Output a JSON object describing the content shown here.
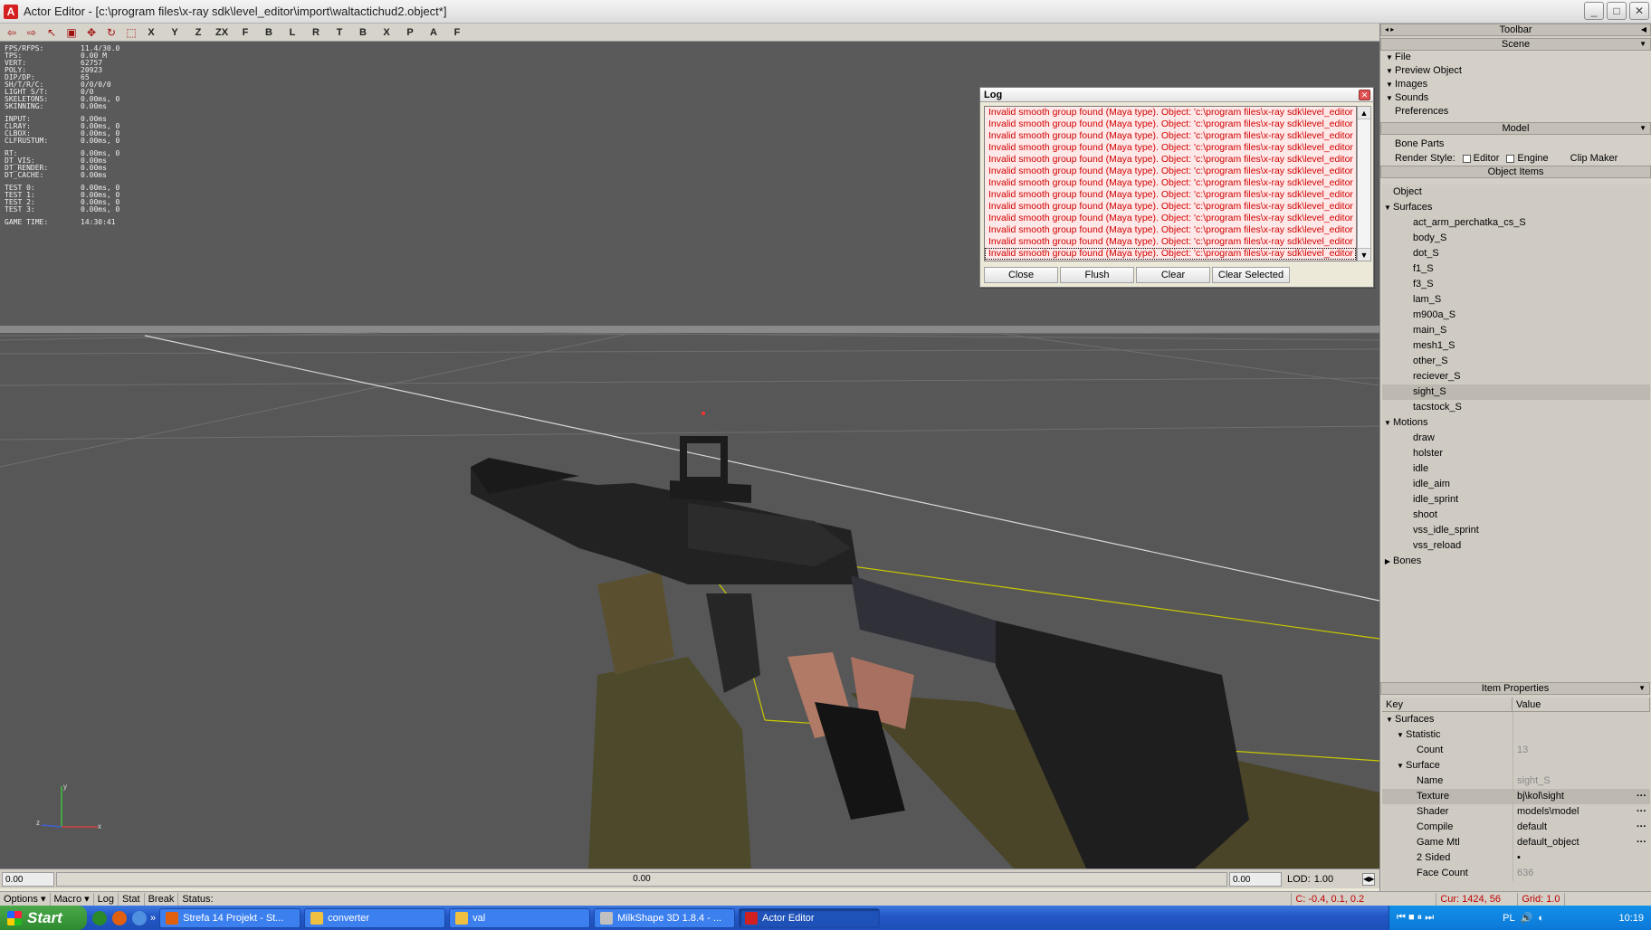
{
  "window": {
    "title": "Actor Editor - [c:\\program files\\x-ray sdk\\level_editor\\import\\waltactichud2.object*]",
    "app_icon": "A"
  },
  "toolbar": {
    "items": [
      "X",
      "Y",
      "Z",
      "ZX",
      "F",
      "B",
      "L",
      "R",
      "T",
      "B",
      "X",
      "P",
      "A",
      "F"
    ]
  },
  "stats": [
    {
      "k": "FPS/RFPS:",
      "v": "11.4/30.0"
    },
    {
      "k": "TPS:",
      "v": "0.00 M"
    },
    {
      "k": "VERT:",
      "v": "62757"
    },
    {
      "k": "POLY:",
      "v": "20923"
    },
    {
      "k": "DIP/DP:",
      "v": "65"
    },
    {
      "k": "SH/T/R/C:",
      "v": "0/0/0/0"
    },
    {
      "k": "LIGHT S/T:",
      "v": "0/0"
    },
    {
      "k": "SKELETONS:",
      "v": "0.00ms, 0"
    },
    {
      "k": "SKINNING:",
      "v": "0.00ms"
    },
    {
      "gap": true
    },
    {
      "k": "INPUT:",
      "v": "0.00ms"
    },
    {
      "k": "CLRAY:",
      "v": "0.00ms, 0"
    },
    {
      "k": "CLBOX:",
      "v": "0.00ms, 0"
    },
    {
      "k": "CLFRUSTUM:",
      "v": "0.00ms, 0"
    },
    {
      "gap": true
    },
    {
      "k": " RT:",
      "v": "0.00ms, 0"
    },
    {
      "k": " DT_VIS:",
      "v": "0.00ms"
    },
    {
      "k": " DT_RENDER:",
      "v": "0.00ms"
    },
    {
      "k": " DT_CACHE:",
      "v": "0.00ms"
    },
    {
      "gap": true
    },
    {
      "k": "TEST 0:",
      "v": "0.00ms, 0"
    },
    {
      "k": "TEST 1:",
      "v": "0.00ms, 0"
    },
    {
      "k": "TEST 2:",
      "v": "0.00ms, 0"
    },
    {
      "k": "TEST 3:",
      "v": "0.00ms, 0"
    },
    {
      "gap": true
    },
    {
      "k": "GAME TIME:",
      "v": "14:30:41"
    }
  ],
  "gizmo": {
    "y": "y",
    "z": "z",
    "x": "x"
  },
  "log": {
    "title": "Log",
    "line": "Invalid smooth group found (Maya type). Object: 'c:\\program files\\x-ray sdk\\level_editor",
    "line_count": 13,
    "buttons": {
      "close": "Close",
      "flush": "Flush",
      "clear": "Clear",
      "clear_selected": "Clear Selected"
    }
  },
  "panel": {
    "toolbar_header": "Toolbar",
    "scene_header": "Scene",
    "scene_items": [
      {
        "label": "File",
        "arrow": "▼"
      },
      {
        "label": "Preview Object",
        "arrow": "▼"
      },
      {
        "label": "Images",
        "arrow": "▼"
      },
      {
        "label": "Sounds",
        "arrow": "▼"
      },
      {
        "label": "Preferences",
        "arrow": ""
      }
    ],
    "model_header": "Model",
    "bone_parts": "Bone Parts",
    "render_style_label": "Render Style:",
    "render_style_editor": "Editor",
    "render_style_engine": "Engine",
    "clip_maker": "Clip Maker",
    "object_items_header": "Object Items",
    "tree": [
      {
        "label": "Object",
        "indent": 0,
        "tri": ""
      },
      {
        "label": "Surfaces",
        "indent": 0,
        "tri": "▼"
      },
      {
        "label": "act_arm_perchatka_cs_S",
        "indent": 1,
        "tri": ""
      },
      {
        "label": "body_S",
        "indent": 1,
        "tri": ""
      },
      {
        "label": "dot_S",
        "indent": 1,
        "tri": ""
      },
      {
        "label": "f1_S",
        "indent": 1,
        "tri": ""
      },
      {
        "label": "f3_S",
        "indent": 1,
        "tri": ""
      },
      {
        "label": "lam_S",
        "indent": 1,
        "tri": ""
      },
      {
        "label": "m900a_S",
        "indent": 1,
        "tri": ""
      },
      {
        "label": "main_S",
        "indent": 1,
        "tri": ""
      },
      {
        "label": "mesh1_S",
        "indent": 1,
        "tri": ""
      },
      {
        "label": "other_S",
        "indent": 1,
        "tri": ""
      },
      {
        "label": "reciever_S",
        "indent": 1,
        "tri": ""
      },
      {
        "label": "sight_S",
        "indent": 1,
        "tri": "",
        "selected": true
      },
      {
        "label": "tacstock_S",
        "indent": 1,
        "tri": ""
      },
      {
        "label": "Motions",
        "indent": 0,
        "tri": "▼"
      },
      {
        "label": "draw",
        "indent": 1,
        "tri": ""
      },
      {
        "label": "holster",
        "indent": 1,
        "tri": ""
      },
      {
        "label": "idle",
        "indent": 1,
        "tri": ""
      },
      {
        "label": "idle_aim",
        "indent": 1,
        "tri": ""
      },
      {
        "label": "idle_sprint",
        "indent": 1,
        "tri": ""
      },
      {
        "label": "shoot",
        "indent": 1,
        "tri": ""
      },
      {
        "label": "vss_idle_sprint",
        "indent": 1,
        "tri": ""
      },
      {
        "label": "vss_reload",
        "indent": 1,
        "tri": ""
      },
      {
        "label": "Bones",
        "indent": 0,
        "tri": "▶"
      }
    ],
    "item_props_header": "Item Properties",
    "props_key_header": "Key",
    "props_value_header": "Value",
    "props": [
      {
        "k": "Surfaces",
        "v": "",
        "indent": 0,
        "tri": "▼"
      },
      {
        "k": "Statistic",
        "v": "",
        "indent": 1,
        "tri": "▼"
      },
      {
        "k": "Count",
        "v": "13",
        "indent": 2,
        "tri": "",
        "dim": true
      },
      {
        "k": "Surface",
        "v": "",
        "indent": 1,
        "tri": "▼"
      },
      {
        "k": "Name",
        "v": "sight_S",
        "indent": 2,
        "tri": "",
        "dim": true
      },
      {
        "k": "Texture",
        "v": "bj\\kol\\sight",
        "indent": 2,
        "tri": "",
        "dots": true,
        "selected": true
      },
      {
        "k": "Shader",
        "v": "models\\model",
        "indent": 2,
        "tri": "",
        "dots": true
      },
      {
        "k": "Compile",
        "v": "default",
        "indent": 2,
        "tri": "",
        "dots": true
      },
      {
        "k": "Game Mtl",
        "v": "default_object",
        "indent": 2,
        "tri": "",
        "dots": true
      },
      {
        "k": "2 Sided",
        "v": "•",
        "indent": 2,
        "tri": ""
      },
      {
        "k": "Face Count",
        "v": "636",
        "indent": 2,
        "tri": "",
        "dim": true
      }
    ]
  },
  "timeline": {
    "start": "0.00",
    "mid": "0.00",
    "end": "0.00",
    "lod_label": "LOD:",
    "lod_value": "1.00"
  },
  "status": {
    "options": "Options",
    "macro": "Macro",
    "log": "Log",
    "stat": "Stat",
    "break": "Break",
    "status": "Status:",
    "coords": "C: -0.4, 0.1, 0.2",
    "cur": "Cur: 1424, 56",
    "grid": "Grid: 1.0"
  },
  "taskbar": {
    "start": "Start",
    "tasks": [
      {
        "label": "Strefa 14 Projekt - St...",
        "color": "#e06010"
      },
      {
        "label": "converter",
        "color": "#f0c040"
      },
      {
        "label": "val",
        "color": "#f0c040"
      },
      {
        "label": "MilkShape 3D 1.8.4 - ...",
        "color": "#c0c0c0"
      },
      {
        "label": "Actor Editor",
        "color": "#d02020",
        "active": true
      }
    ],
    "lang": "PL",
    "clock": "10:19"
  },
  "colors": {
    "viewport": "#575757",
    "log_text": "#d00000",
    "log_bg": "#ffe8e8",
    "taskbar": "#2458c8"
  }
}
